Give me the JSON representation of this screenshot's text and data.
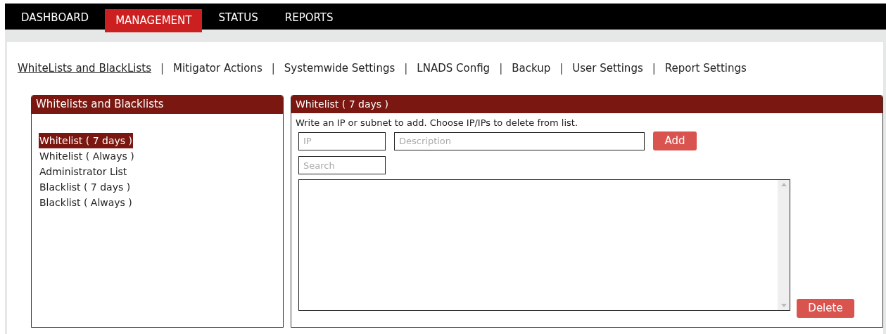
{
  "tabs": [
    {
      "label": "DASHBOARD",
      "selected": false
    },
    {
      "label": "MANAGEMENT",
      "selected": true
    },
    {
      "label": "STATUS",
      "selected": false
    },
    {
      "label": "REPORTS",
      "selected": false
    }
  ],
  "subnav": [
    {
      "label": "WhiteLists and BlackLists",
      "selected": true
    },
    {
      "label": "Mitigator Actions",
      "selected": false
    },
    {
      "label": "Systemwide Settings",
      "selected": false
    },
    {
      "label": "LNADS Config",
      "selected": false
    },
    {
      "label": "Backup",
      "selected": false
    },
    {
      "label": "User Settings",
      "selected": false
    },
    {
      "label": "Report Settings",
      "selected": false
    }
  ],
  "separator": "|",
  "lists_panel": {
    "title": "Whitelists and Blacklists",
    "items": [
      {
        "label": "Whitelist ( 7 days )",
        "selected": true
      },
      {
        "label": "Whitelist ( Always )",
        "selected": false
      },
      {
        "label": "Administrator List",
        "selected": false
      },
      {
        "label": "Blacklist ( 7 days )",
        "selected": false
      },
      {
        "label": "Blacklist ( Always )",
        "selected": false
      }
    ]
  },
  "detail_panel": {
    "title": "Whitelist ( 7 days )",
    "instructions": "Write an IP or subnet to add. Choose IP/IPs to delete from list.",
    "ip_field": {
      "placeholder": "IP"
    },
    "description_field": {
      "placeholder": "Description"
    },
    "add_button": "Add",
    "search_field": {
      "placeholder": "Search"
    },
    "delete_button": "Delete"
  }
}
